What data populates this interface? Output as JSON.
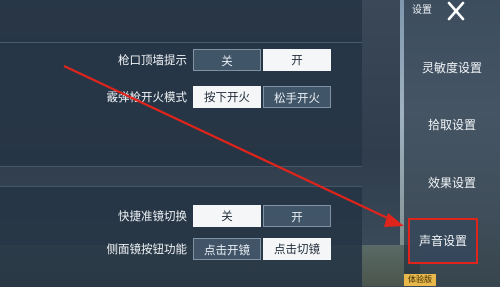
{
  "settings": {
    "top_rows": [
      {
        "label": "枪口顶墙提示",
        "options": [
          "关",
          "开"
        ],
        "selected": 1
      },
      {
        "label": "霰弹枪开火模式",
        "options": [
          "按下开火",
          "松手开火"
        ],
        "selected": 0
      }
    ],
    "bottom_rows": [
      {
        "label": "快捷准镜切换",
        "options": [
          "关",
          "开"
        ],
        "selected": 0
      },
      {
        "label": "侧面镜按钮功能",
        "options": [
          "点击开镜",
          "点击切镜"
        ],
        "selected": 1
      }
    ]
  },
  "sidebar": {
    "title": "设置",
    "close_icon": "close-icon",
    "items": [
      {
        "label": "灵敏度设置"
      },
      {
        "label": "拾取设置"
      },
      {
        "label": "效果设置"
      },
      {
        "label": "声音设置"
      }
    ],
    "active_index": 3,
    "badge": "体验版"
  },
  "colors": {
    "annotation": "#e0241b",
    "selected_bg": "#f4f6f8",
    "unselected_bg": "#46596e"
  }
}
